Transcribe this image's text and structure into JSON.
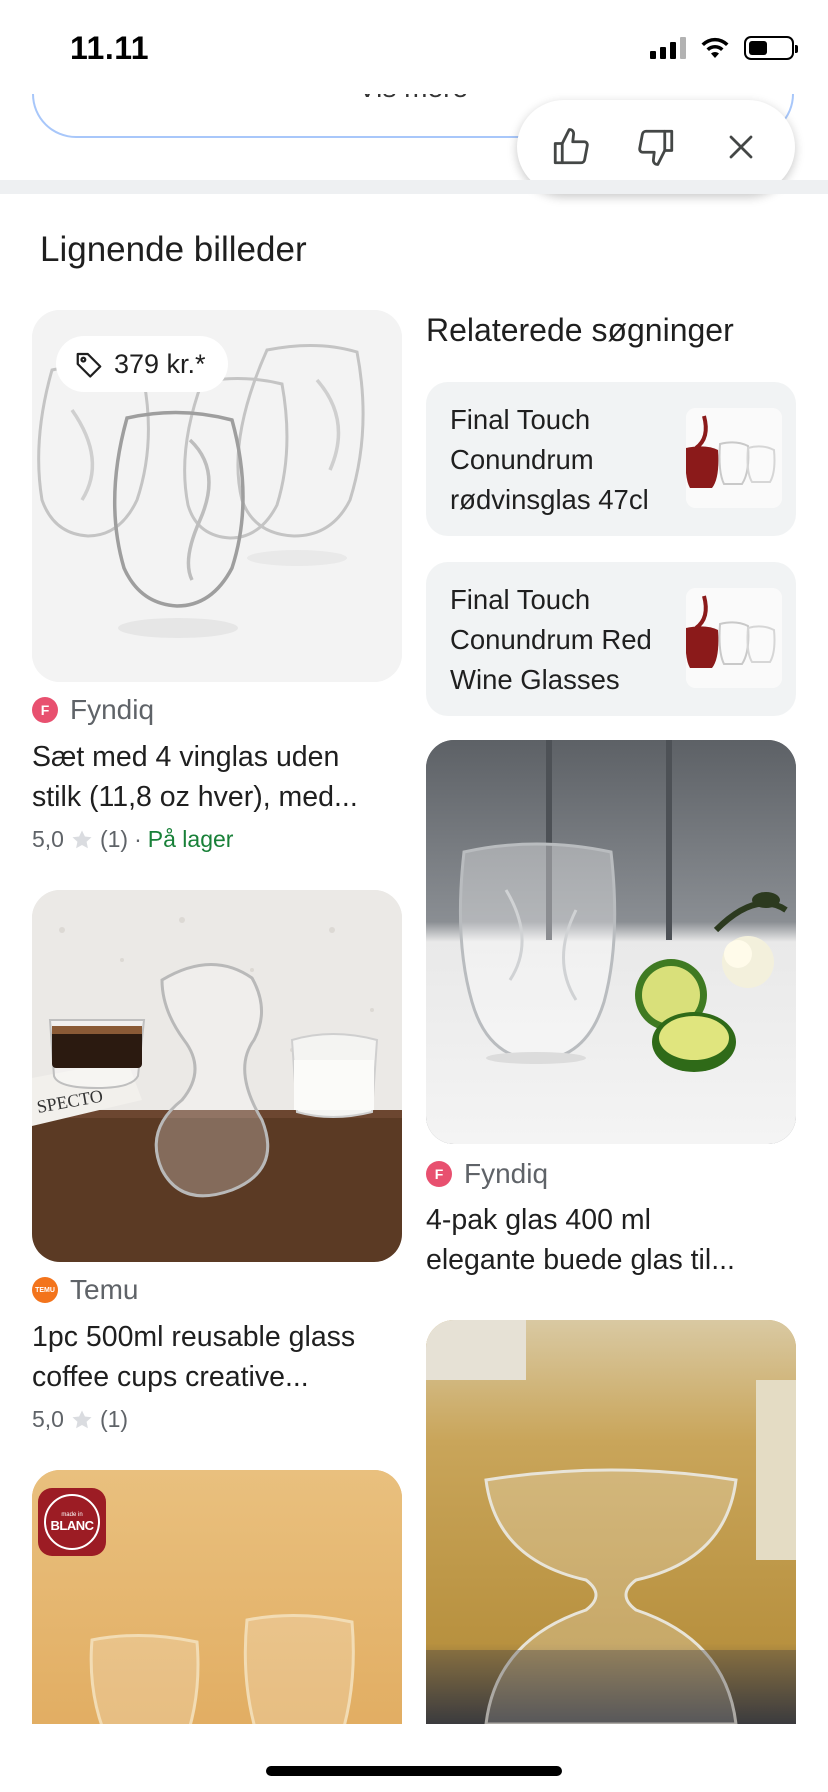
{
  "status_bar": {
    "time": "11.11"
  },
  "top_pill": {
    "label": "Vis mere"
  },
  "section": {
    "title": "Lignende billeder"
  },
  "results": {
    "left": [
      {
        "price": "379 kr.*",
        "source": "Fyndiq",
        "source_initial": "F",
        "title_line1": "Sæt med 4 vinglas uden",
        "title_line2": "stilk (11,8 oz hver), med...",
        "rating": "5,0",
        "reviews": "(1)",
        "separator": "·",
        "stock": "På lager"
      },
      {
        "source": "Temu",
        "source_initial": "TEMU",
        "title_line1": "1pc 500ml reusable glass",
        "title_line2": "coffee cups creative...",
        "rating": "5,0",
        "reviews": "(1)",
        "image_text": "SPECTO"
      },
      {
        "logo_text": "BLANC",
        "logo_small": "made in"
      }
    ],
    "right": [
      {
        "source": "Fyndiq",
        "source_initial": "F",
        "title_line1": "4-pak glas 400 ml",
        "title_line2": "elegante buede glas til..."
      }
    ]
  },
  "related": {
    "title": "Relaterede søgninger",
    "items": [
      {
        "line1": "Final Touch",
        "line2": "Conundrum",
        "line3": "rødvinsglas 47cl"
      },
      {
        "line1": "Final Touch",
        "line2": "Conundrum Red",
        "line3": "Wine Glasses"
      }
    ]
  },
  "colors": {
    "fyndiq": "#e8506f",
    "temu": "#f3741c",
    "in_stock": "#188038",
    "pill_border": "#a8c7fa"
  },
  "icons": [
    "thumbs-up-icon",
    "thumbs-down-icon",
    "close-icon",
    "price-tag-icon",
    "star-icon"
  ]
}
